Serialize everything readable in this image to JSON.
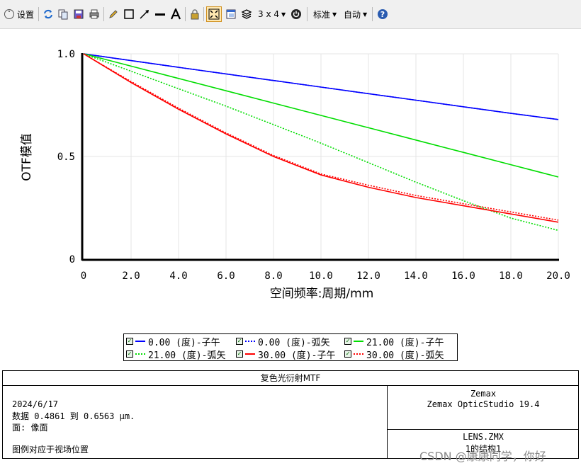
{
  "toolbar": {
    "settings_label": "设置",
    "layout_label": "3 x 4",
    "standard_label": "标准",
    "auto_label": "自动"
  },
  "chart_data": {
    "type": "line",
    "xlabel": "空间频率:周期/mm",
    "ylabel": "OTF模值",
    "xlim": [
      0,
      20
    ],
    "ylim": [
      0,
      1
    ],
    "xticks": [
      "0",
      "2.0",
      "4.0",
      "6.0",
      "8.0",
      "10.0",
      "12.0",
      "14.0",
      "16.0",
      "18.0",
      "20.0"
    ],
    "yticks": [
      "0",
      "0.5",
      "1.0"
    ],
    "grid": true,
    "legend_position": "bottom",
    "series": [
      {
        "name": "0.00 (度)-子午",
        "color": "#0000ff",
        "dash": false,
        "x": [
          0,
          2,
          4,
          6,
          8,
          10,
          12,
          14,
          16,
          18,
          20
        ],
        "y": [
          1.0,
          0.967,
          0.934,
          0.902,
          0.87,
          0.838,
          0.806,
          0.774,
          0.742,
          0.71,
          0.68
        ]
      },
      {
        "name": "0.00 (度)-弧矢",
        "color": "#0000ff",
        "dash": true,
        "x": [
          0,
          2,
          4,
          6,
          8,
          10,
          12,
          14,
          16,
          18,
          20
        ],
        "y": [
          1.0,
          0.967,
          0.934,
          0.902,
          0.87,
          0.838,
          0.806,
          0.774,
          0.742,
          0.71,
          0.68
        ]
      },
      {
        "name": "21.00 (度)-子午",
        "color": "#00dd00",
        "dash": false,
        "x": [
          0,
          2,
          4,
          6,
          8,
          10,
          12,
          14,
          16,
          18,
          20
        ],
        "y": [
          1.0,
          0.94,
          0.88,
          0.82,
          0.76,
          0.7,
          0.64,
          0.58,
          0.52,
          0.46,
          0.4
        ]
      },
      {
        "name": "21.00 (度)-弧矢",
        "color": "#00dd00",
        "dash": true,
        "x": [
          0,
          2,
          4,
          6,
          8,
          10,
          12,
          14,
          16,
          18,
          20
        ],
        "y": [
          1.0,
          0.915,
          0.83,
          0.745,
          0.655,
          0.565,
          0.47,
          0.375,
          0.285,
          0.2,
          0.14
        ]
      },
      {
        "name": "30.00 (度)-子午",
        "color": "#ff0000",
        "dash": false,
        "x": [
          0,
          2,
          4,
          6,
          8,
          10,
          12,
          14,
          16,
          18,
          20
        ],
        "y": [
          1.0,
          0.86,
          0.73,
          0.61,
          0.5,
          0.41,
          0.35,
          0.3,
          0.26,
          0.22,
          0.18
        ]
      },
      {
        "name": "30.00 (度)-弧矢",
        "color": "#ff0000",
        "dash": true,
        "x": [
          0,
          2,
          4,
          6,
          8,
          10,
          12,
          14,
          16,
          18,
          20
        ],
        "y": [
          1.0,
          0.865,
          0.735,
          0.615,
          0.505,
          0.415,
          0.36,
          0.31,
          0.27,
          0.23,
          0.19
        ]
      }
    ]
  },
  "info": {
    "title": "复色光衍射MTF",
    "date": "2024/6/17",
    "data_line": "数据 0.4861 到 0.6563 μm.",
    "surface_line": "面: 像面",
    "legend_note": "图例对应于视场位置",
    "company": "Zemax",
    "product": "Zemax OpticStudio 19.4",
    "file": "LENS.ZMX",
    "config": "1的结构1"
  },
  "watermark": "CSDN @康康同学，你好"
}
